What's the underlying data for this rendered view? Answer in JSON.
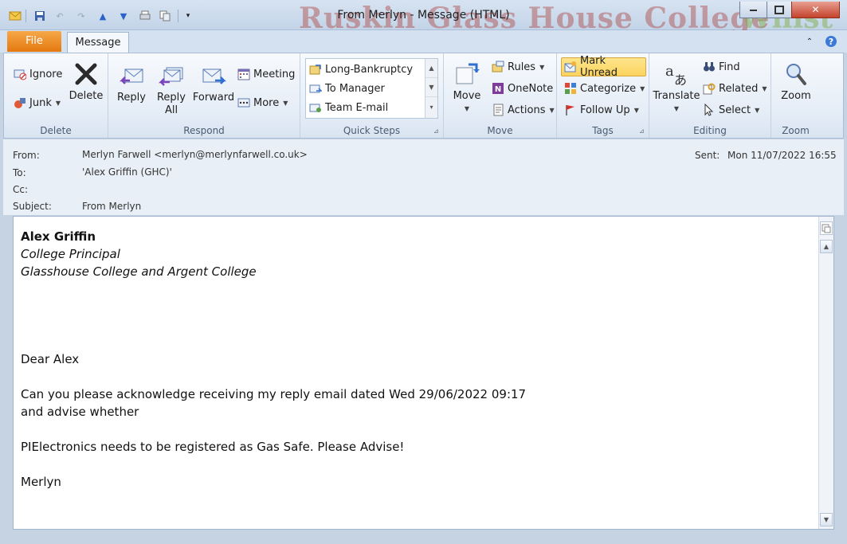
{
  "window": {
    "title": "From Merlyn  -  Message (HTML)",
    "watermark": "Ruskin Glass House College",
    "watermark_green": "Whist"
  },
  "tabs": {
    "file": "File",
    "message": "Message"
  },
  "ribbon": {
    "delete_group": {
      "label": "Delete",
      "ignore": "Ignore",
      "junk": "Junk",
      "delete": "Delete"
    },
    "respond_group": {
      "label": "Respond",
      "reply": "Reply",
      "reply_all_line1": "Reply",
      "reply_all_line2": "All",
      "forward": "Forward",
      "meeting": "Meeting",
      "more": "More"
    },
    "quicksteps_group": {
      "label": "Quick Steps",
      "items": [
        "Long-Bankruptcy",
        "To Manager",
        "Team E-mail"
      ]
    },
    "move_group": {
      "label": "Move",
      "move": "Move",
      "rules": "Rules",
      "onenote": "OneNote",
      "actions": "Actions"
    },
    "tags_group": {
      "label": "Tags",
      "mark_unread": "Mark Unread",
      "categorize": "Categorize",
      "follow_up": "Follow Up"
    },
    "editing_group": {
      "label": "Editing",
      "translate": "Translate",
      "find": "Find",
      "related": "Related",
      "select": "Select"
    },
    "zoom_group": {
      "label": "Zoom",
      "zoom": "Zoom"
    }
  },
  "headers": {
    "from_label": "From:",
    "from_value": "Merlyn Farwell <merlyn@merlynfarwell.co.uk>",
    "to_label": "To:",
    "to_value": "'Alex Griffin (GHC)'",
    "cc_label": "Cc:",
    "cc_value": "",
    "subject_label": "Subject:",
    "subject_value": "From Merlyn",
    "sent_label": "Sent:",
    "sent_value": "Mon 11/07/2022 16:55"
  },
  "body": {
    "recipient_name": "Alex Griffin",
    "recipient_title": "College Principal",
    "recipient_org": "Glasshouse College and Argent College",
    "greeting": "Dear Alex",
    "line1": "Can you please acknowledge  receiving my reply email dated Wed 29/06/2022 09:17",
    "line2": "and advise whether",
    "line3": "PIElectronics needs to be registered as Gas Safe. Please Advise!",
    "signoff": "Merlyn"
  }
}
